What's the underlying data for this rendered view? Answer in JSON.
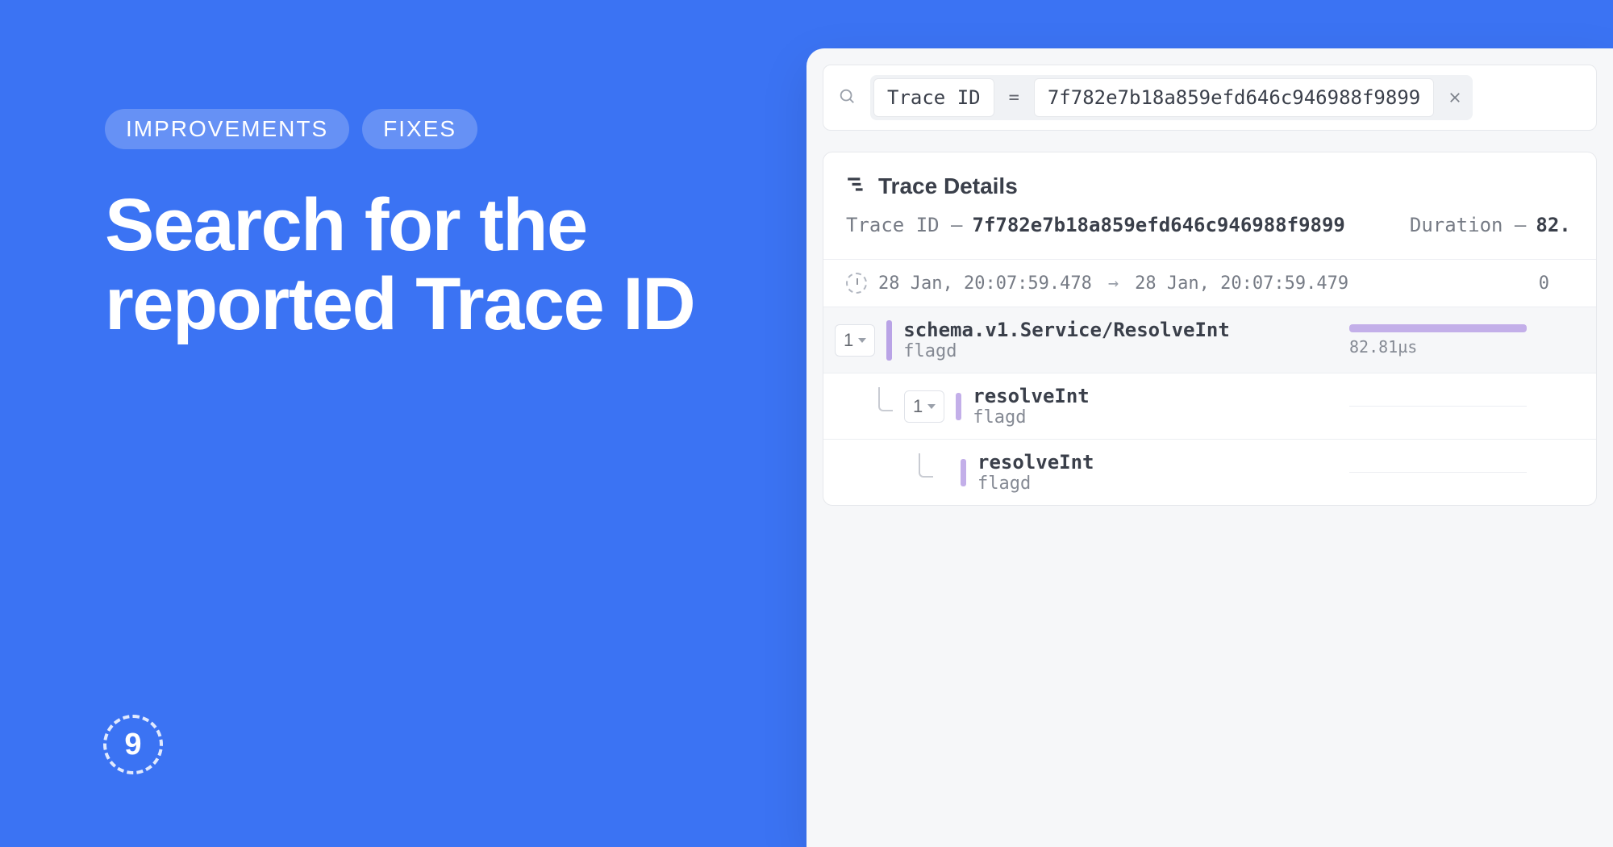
{
  "pills": {
    "a": "IMPROVEMENTS",
    "b": "FIXES"
  },
  "heading": "Search for the reported Trace ID",
  "badge": "9",
  "search": {
    "field": "Trace ID",
    "op": "=",
    "value": "7f782e7b18a859efd646c946988f9899"
  },
  "details": {
    "title": "Trace Details",
    "trace_label": "Trace ID —",
    "trace_id": "7f782e7b18a859efd646c946988f9899",
    "duration_label": "Duration —",
    "duration_value": "82."
  },
  "timeline": {
    "start": "28 Jan, 20:07:59.478",
    "end": "28 Jan, 20:07:59.479",
    "zero": "0"
  },
  "spans": [
    {
      "count": "1",
      "name": "schema.v1.Service/ResolveInt",
      "service": "flagd",
      "dur": "82.81µs"
    },
    {
      "count": "1",
      "name": "resolveInt",
      "service": "flagd"
    },
    {
      "name": "resolveInt",
      "service": "flagd"
    }
  ]
}
